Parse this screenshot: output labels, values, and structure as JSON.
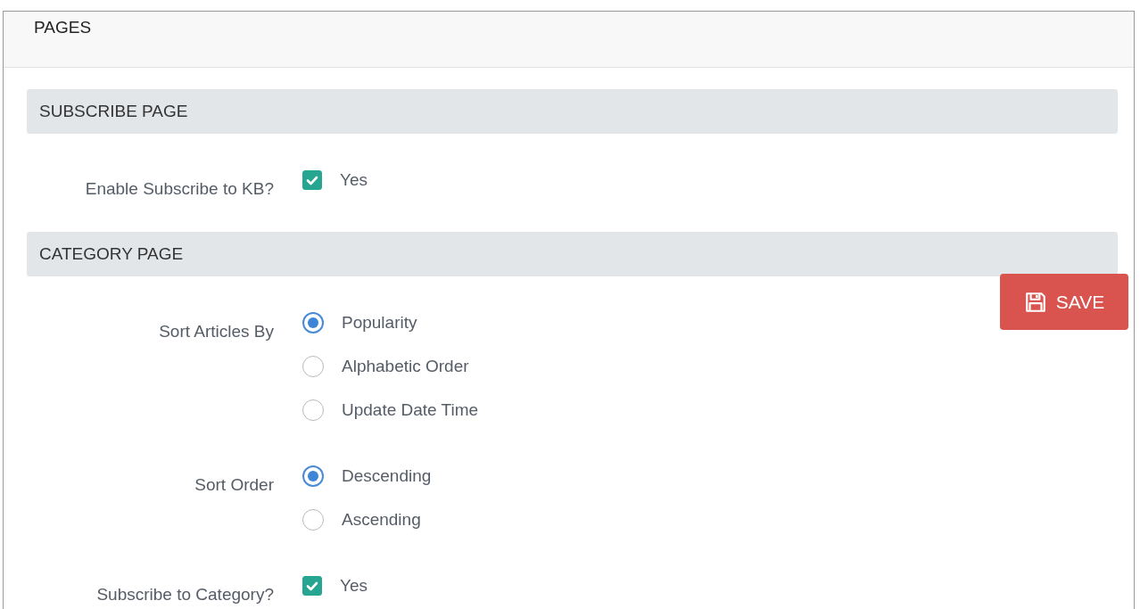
{
  "panel": {
    "title": "PAGES"
  },
  "sections": [
    {
      "title": "SUBSCRIBE PAGE",
      "fields": [
        {
          "kind": "checkbox",
          "label": "Enable Subscribe to KB?",
          "options": [
            {
              "label": "Yes",
              "checked": true
            }
          ]
        }
      ]
    },
    {
      "title": "CATEGORY PAGE",
      "fields": [
        {
          "kind": "radio",
          "label": "Sort Articles By",
          "options": [
            {
              "label": "Popularity",
              "selected": true
            },
            {
              "label": "Alphabetic Order",
              "selected": false
            },
            {
              "label": "Update Date Time",
              "selected": false
            }
          ]
        },
        {
          "kind": "radio",
          "label": "Sort Order",
          "options": [
            {
              "label": "Descending",
              "selected": true
            },
            {
              "label": "Ascending",
              "selected": false
            }
          ]
        },
        {
          "kind": "checkbox",
          "label": "Subscribe to Category?",
          "options": [
            {
              "label": "Yes",
              "checked": true
            }
          ]
        }
      ]
    }
  ],
  "save_button": {
    "label": "SAVE"
  }
}
